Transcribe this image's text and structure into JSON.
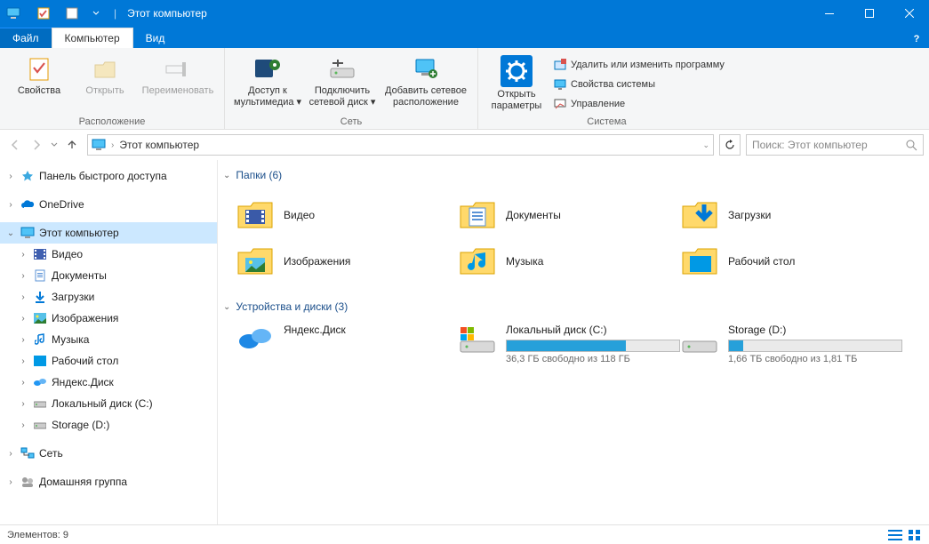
{
  "window": {
    "title": "Этот компьютер"
  },
  "menutabs": {
    "file": "Файл",
    "computer": "Компьютер",
    "view": "Вид"
  },
  "ribbon": {
    "group_location": "Расположение",
    "group_network": "Сеть",
    "group_system": "Система",
    "properties": "Свойства",
    "open": "Открыть",
    "rename": "Переименовать",
    "media_access": "Доступ к\nмультимедиа",
    "map_drive": "Подключить\nсетевой диск",
    "add_netloc": "Добавить сетевое\nрасположение",
    "open_settings": "Открыть\nпараметры",
    "uninstall": "Удалить или изменить программу",
    "sys_props": "Свойства системы",
    "manage": "Управление"
  },
  "address": {
    "crumb": "Этот компьютер"
  },
  "search": {
    "placeholder": "Поиск: Этот компьютер"
  },
  "nav": {
    "quick_access": "Панель быстрого доступа",
    "onedrive": "OneDrive",
    "this_pc": "Этот компьютер",
    "videos": "Видео",
    "documents": "Документы",
    "downloads": "Загрузки",
    "pictures": "Изображения",
    "music": "Музыка",
    "desktop": "Рабочий стол",
    "yadisk": "Яндекс.Диск",
    "local_c": "Локальный диск (C:)",
    "storage_d": "Storage (D:)",
    "network": "Сеть",
    "homegroup": "Домашняя группа"
  },
  "sections": {
    "folders": "Папки (6)",
    "drives": "Устройства и диски (3)"
  },
  "folders": {
    "videos": "Видео",
    "documents": "Документы",
    "downloads": "Загрузки",
    "pictures": "Изображения",
    "music": "Музыка",
    "desktop": "Рабочий стол"
  },
  "drives": {
    "yadisk": "Яндекс.Диск",
    "local_c_name": "Локальный диск (C:)",
    "local_c_free": "36,3 ГБ свободно из 118 ГБ",
    "local_c_fill_pct": 69,
    "storage_d_name": "Storage (D:)",
    "storage_d_free": "1,66 ТБ свободно из 1,81 ТБ",
    "storage_d_fill_pct": 8
  },
  "status": {
    "items": "Элементов: 9"
  }
}
